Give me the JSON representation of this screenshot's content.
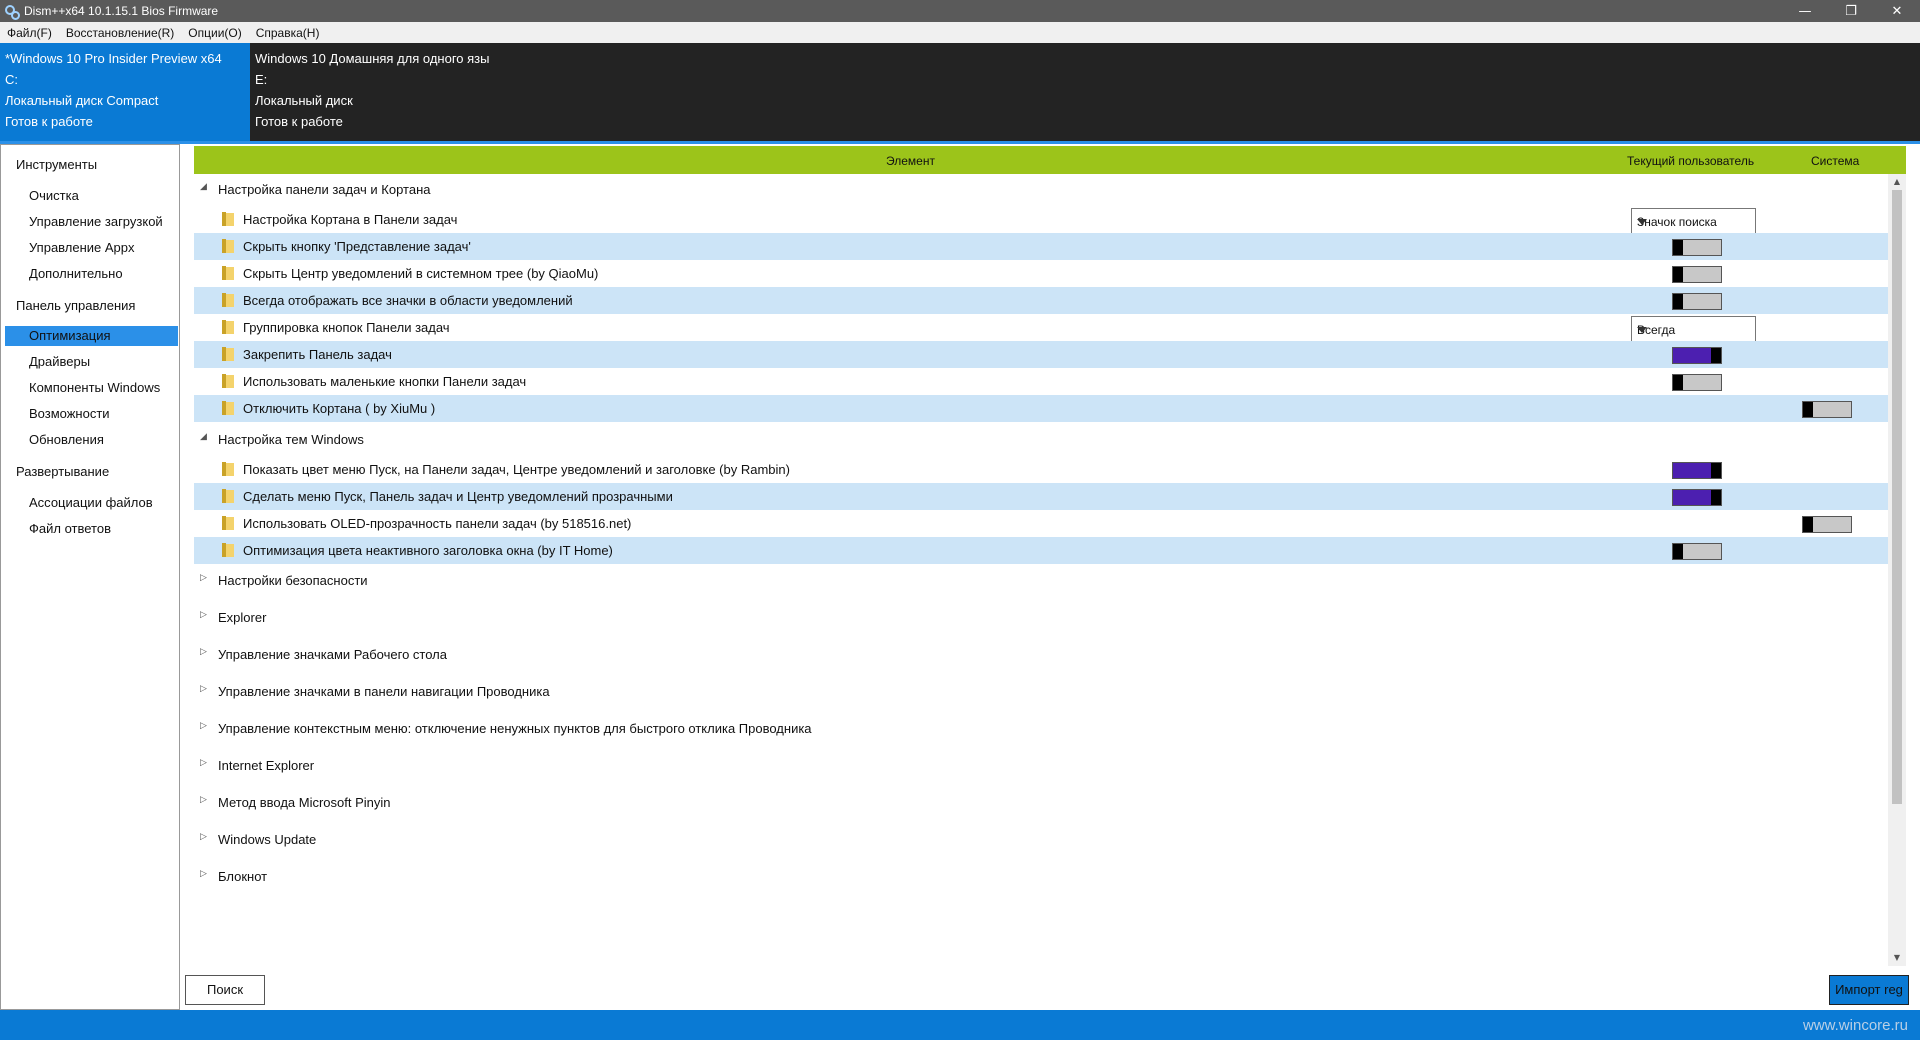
{
  "window": {
    "title": "Dism++x64 10.1.15.1 Bios Firmware",
    "controls": {
      "minimize": "—",
      "restore": "❐",
      "close": "✕"
    }
  },
  "menu": [
    "Файл(F)",
    "Восстановление(R)",
    "Опции(O)",
    "Справка(H)"
  ],
  "images": [
    {
      "name": "*Windows 10 Pro Insider Preview x64",
      "drive": "C:",
      "disk": "Локальный диск Compact",
      "status": "Готов к работе"
    },
    {
      "name": "Windows 10 Домашняя для одного язы",
      "drive": "E:",
      "disk": "Локальный диск",
      "status": "Готов к работе"
    }
  ],
  "sidebar": {
    "sections": [
      {
        "title": "Инструменты",
        "items": [
          "Очистка",
          "Управление загрузкой",
          "Управление Appx",
          "Дополнительно"
        ]
      },
      {
        "title": "Панель управления",
        "items": [
          "Оптимизация",
          "Драйверы",
          "Компоненты Windows",
          "Возможности",
          "Обновления"
        ]
      },
      {
        "title": "Развертывание",
        "items": [
          "Ассоциации файлов",
          "Файл ответов"
        ]
      }
    ],
    "selected": "Оптимизация"
  },
  "table": {
    "headers": {
      "element": "Элемент",
      "current_user": "Текущий пользователь",
      "system": "Система"
    },
    "group1": {
      "title": "Настройка панели задач и Кортана",
      "rows": [
        {
          "label": "Настройка Кортана в Панели задач",
          "user_value": "Значок поиска"
        },
        {
          "label": "Скрыть кнопку 'Представление задач'",
          "user_toggle": "off"
        },
        {
          "label": "Скрыть Центр уведомлений в системном трее (by QiaoMu)",
          "user_toggle": "off"
        },
        {
          "label": "Всегда отображать все значки в области уведомлений",
          "user_toggle": "off"
        },
        {
          "label": "Группировка кнопок Панели задач",
          "user_value": "Всегда"
        },
        {
          "label": "Закрепить Панель задач",
          "user_toggle": "on"
        },
        {
          "label": "Использовать маленькие кнопки Панели задач",
          "user_toggle": "off"
        },
        {
          "label": "Отключить Кортана ( by XiuMu )",
          "system_toggle": "off"
        }
      ]
    },
    "group2": {
      "title": "Настройка тем Windows",
      "rows": [
        {
          "label": "Показать цвет меню Пуск, на Панели задач, Центре уведомлений и заголовке (by Rambin)",
          "user_toggle": "on"
        },
        {
          "label": "Сделать меню Пуск, Панель задач и Центр уведомлений прозрачными",
          "user_toggle": "on"
        },
        {
          "label": "Использовать OLED-прозрачность панели задач (by 518516.net)",
          "system_toggle": "off"
        },
        {
          "label": "Оптимизация цвета неактивного заголовка окна (by IT Home)",
          "user_toggle": "off"
        }
      ]
    },
    "collapsed_groups": [
      "Настройки безопасности",
      "Explorer",
      "Управление значками Рабочего стола",
      "Управление значками в панели навигации Проводника",
      "Управление контекстным меню: отключение ненужных пунктов для быстрого отклика Проводника",
      "Internet Explorer",
      "Метод ввода Microsoft Pinyin",
      "Windows Update",
      "Блокнот"
    ]
  },
  "buttons": {
    "search": "Поиск",
    "import_reg": "Импорт reg"
  },
  "watermark": "www.wincore.ru",
  "colors": {
    "accent": "#0a7ad4",
    "header_green": "#9cc41a",
    "row_highlight": "#cce4f7",
    "toggle_on": "#4c1fb0"
  }
}
